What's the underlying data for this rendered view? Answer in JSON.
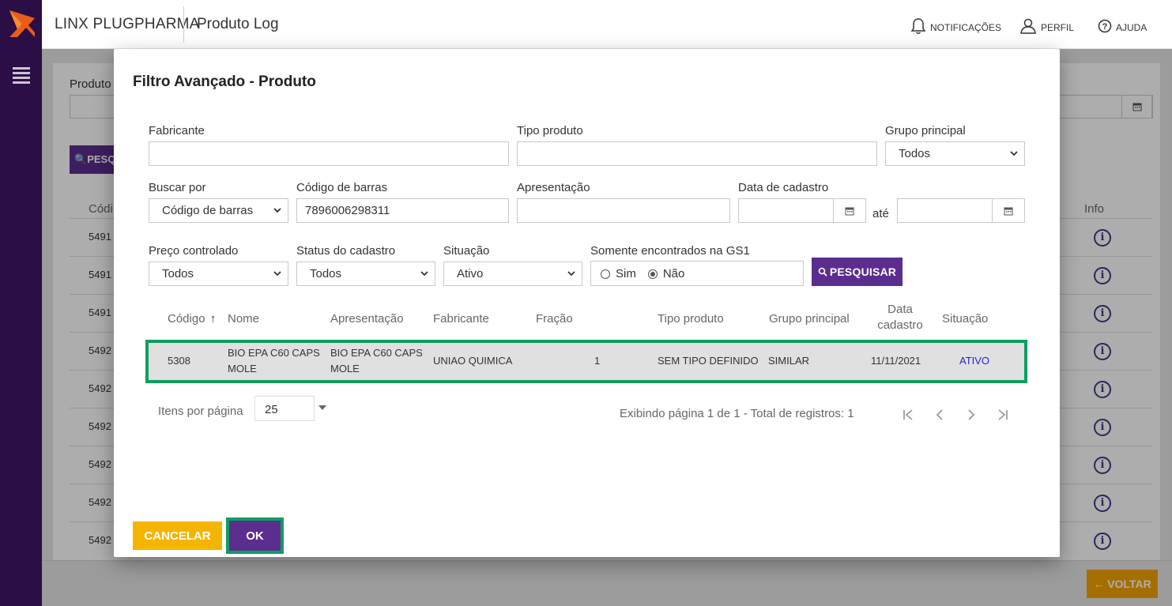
{
  "app": {
    "brand": "LINX PLUGPHARMA",
    "page_title": "Produto Log",
    "notifications_label": "NOTIFICAÇÕES",
    "profile_label": "PERFIL",
    "help_label": "AJUDA"
  },
  "background": {
    "field_label": "Produto",
    "search_label": "PESQ",
    "col_code": "Códi",
    "col_info": "Info",
    "rows": [
      "5491",
      "5491",
      "5491",
      "5492",
      "5492",
      "5492",
      "5492",
      "5492",
      "5492"
    ],
    "back_label": "← VOLTAR"
  },
  "modal": {
    "title": "Filtro Avançado - Produto",
    "fields": {
      "fabricante_label": "Fabricante",
      "fabricante_value": "",
      "tipo_produto_label": "Tipo produto",
      "tipo_produto_value": "",
      "grupo_principal_label": "Grupo principal",
      "grupo_principal_value": "Todos",
      "buscar_por_label": "Buscar por",
      "buscar_por_value": "Código de barras",
      "codigo_barras_label": "Código de barras",
      "codigo_barras_value": "7896006298311",
      "apresentacao_label": "Apresentação",
      "apresentacao_value": "",
      "data_cadastro_label": "Data de cadastro",
      "data_cadastro_from": "",
      "ate_label": "até",
      "data_cadastro_to": "",
      "preco_controlado_label": "Preço controlado",
      "preco_controlado_value": "Todos",
      "status_cadastro_label": "Status do cadastro",
      "status_cadastro_value": "Todos",
      "situacao_label": "Situação",
      "situacao_value": "Ativo",
      "gs1_label": "Somente encontrados na GS1",
      "gs1_sim": "Sim",
      "gs1_nao": "Não",
      "gs1_selected": "Não"
    },
    "search_label": "PESQUISAR",
    "table": {
      "headers": {
        "codigo": "Código",
        "sort_arrow": "↑",
        "nome": "Nome",
        "apresentacao": "Apresentação",
        "fabricante": "Fabricante",
        "fracao": "Fração",
        "tipo_produto": "Tipo produto",
        "grupo_principal": "Grupo principal",
        "data_cadastro_1": "Data",
        "data_cadastro_2": "cadastro",
        "situacao": "Situação"
      },
      "rows": [
        {
          "codigo": "5308",
          "nome_1": "BIO EPA C60 CAPS",
          "nome_2": "MOLE",
          "apresentacao_1": "BIO EPA C60 CAPS",
          "apresentacao_2": "MOLE",
          "fabricante": "UNIAO QUIMICA",
          "fracao": "1",
          "tipo_produto": "SEM TIPO DEFINIDO",
          "grupo_principal": "SIMILAR",
          "data_cadastro": "11/11/2021",
          "situacao": "ATIVO"
        }
      ]
    },
    "pagination": {
      "items_per_page_label": "Itens por página",
      "items_per_page_value": "25",
      "info": "Exibindo página 1 de 1 - Total de registros: 1"
    },
    "cancel_label": "CANCELAR",
    "ok_label": "OK"
  },
  "colors": {
    "sidebar": "#2a0e45",
    "primary": "#5b2d8e",
    "warning": "#f5b400",
    "highlight_border": "#0e9e60",
    "active_status": "#2424c9"
  }
}
